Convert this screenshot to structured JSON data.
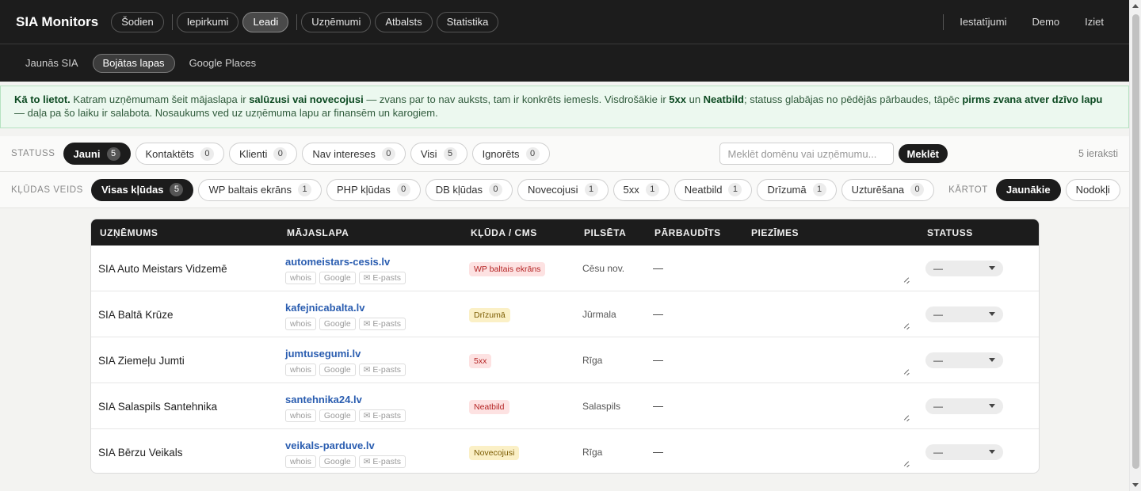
{
  "app": {
    "title": "SIA Monitors"
  },
  "nav": {
    "main": [
      {
        "label": "Šodien",
        "active": false
      },
      {
        "label": "Iepirkumi",
        "active": false
      },
      {
        "label": "Leadi",
        "active": true
      },
      {
        "label": "Uzņēmumi",
        "active": false
      },
      {
        "label": "Atbalsts",
        "active": false
      },
      {
        "label": "Statistika",
        "active": false
      }
    ],
    "right": [
      "Iestatījumi",
      "Demo",
      "Iziet"
    ],
    "sub": [
      {
        "label": "Jaunās SIA",
        "active": false
      },
      {
        "label": "Bojātas lapas",
        "active": true
      },
      {
        "label": "Google Places",
        "active": false
      }
    ]
  },
  "info": {
    "t1": "Kā to lietot.",
    "t2": " Katram uzņēmumam šeit mājaslapa ir ",
    "t3": "salūzusi vai novecojusi",
    "t4": " — zvans par to nav auksts, tam ir konkrēts iemesls. Visdrošākie ir ",
    "t5": "5xx",
    "t6": " un ",
    "t7": "Neatbild",
    "t8": "; statuss glabājas no pēdējās pārbaudes, tāpēc ",
    "t9": "pirms zvana atver dzīvo lapu",
    "t10": " — daļa pa šo laiku ir salabota. Nosaukums ved uz uzņēmuma lapu ar finansēm un karogiem."
  },
  "filters": {
    "status_label": "STATUSS",
    "status": [
      {
        "label": "Jauni",
        "count": "5",
        "active": true
      },
      {
        "label": "Kontaktēts",
        "count": "0",
        "active": false
      },
      {
        "label": "Klienti",
        "count": "0",
        "active": false
      },
      {
        "label": "Nav intereses",
        "count": "0",
        "active": false
      },
      {
        "label": "Visi",
        "count": "5",
        "active": false
      },
      {
        "label": "Ignorēts",
        "count": "0",
        "active": false
      }
    ],
    "search_placeholder": "Meklēt domēnu vai uzņēmumu...",
    "search_button": "Meklēt",
    "records": "5 ieraksti",
    "error_label": "KĻŪDAS VEIDS",
    "errors": [
      {
        "label": "Visas kļūdas",
        "count": "5",
        "active": true
      },
      {
        "label": "WP baltais ekrāns",
        "count": "1",
        "active": false
      },
      {
        "label": "PHP kļūdas",
        "count": "0",
        "active": false
      },
      {
        "label": "DB kļūdas",
        "count": "0",
        "active": false
      },
      {
        "label": "Novecojusi",
        "count": "1",
        "active": false
      },
      {
        "label": "5xx",
        "count": "1",
        "active": false
      },
      {
        "label": "Neatbild",
        "count": "1",
        "active": false
      },
      {
        "label": "Drīzumā",
        "count": "1",
        "active": false
      },
      {
        "label": "Uzturēšana",
        "count": "0",
        "active": false
      }
    ],
    "sort_label": "KĀRTOT",
    "sort": [
      {
        "label": "Jaunākie",
        "active": true
      },
      {
        "label": "Nodokļi",
        "active": false
      }
    ]
  },
  "table": {
    "headers": [
      "UZŅĒMUMS",
      "MĀJASLAPA",
      "KĻŪDA / CMS",
      "PILSĒTA",
      "PĀRBAUDĪTS",
      "PIEZĪMES",
      "STATUSS"
    ],
    "mini_buttons": [
      "whois",
      "Google",
      "✉ E-pasts"
    ],
    "rows": [
      {
        "company": "SIA Auto Meistars Vidzemē",
        "domain": "automeistars-cesis.lv",
        "error": "WP baltais ekrāns",
        "error_color": "#fde2e2",
        "error_text": "#b42323",
        "city": "Cēsu nov.",
        "checked": "—",
        "status": "—"
      },
      {
        "company": "SIA Baltā Krūze",
        "domain": "kafejnicabalta.lv",
        "error": "Drīzumā",
        "error_color": "#fbf0c6",
        "error_text": "#7a5a00",
        "city": "Jūrmala",
        "checked": "—",
        "status": "—"
      },
      {
        "company": "SIA Ziemeļu Jumti",
        "domain": "jumtusegumi.lv",
        "error": "5xx",
        "error_color": "#fde2e2",
        "error_text": "#b42323",
        "city": "Rīga",
        "checked": "—",
        "status": "—"
      },
      {
        "company": "SIA Salaspils Santehnika",
        "domain": "santehnika24.lv",
        "error": "Neatbild",
        "error_color": "#fde2e2",
        "error_text": "#b42323",
        "city": "Salaspils",
        "checked": "—",
        "status": "—"
      },
      {
        "company": "SIA Bērzu Veikals",
        "domain": "veikals-parduve.lv",
        "error": "Novecojusi",
        "error_color": "#fbf0c6",
        "error_text": "#7a5a00",
        "city": "Rīga",
        "checked": "—",
        "status": "—"
      }
    ]
  }
}
